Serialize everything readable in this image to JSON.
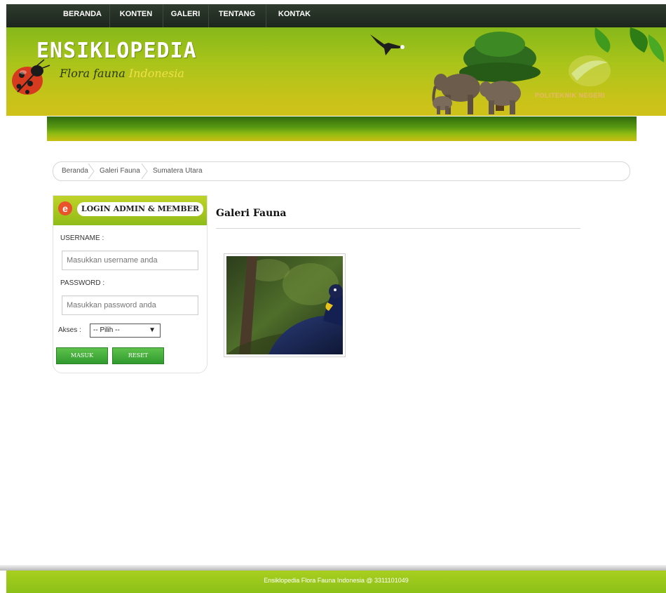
{
  "nav": {
    "items": [
      {
        "label": "BERANDA"
      },
      {
        "label": "KONTEN"
      },
      {
        "label": "GALERI"
      },
      {
        "label": "TENTANG"
      },
      {
        "label": "KONTAK"
      }
    ]
  },
  "header": {
    "title": "ENSIKLOPEDIA",
    "subtitle_main": "Flora fauna",
    "subtitle_accent": "Indonesia",
    "partner": "POLITEKNIK NEGERI"
  },
  "breadcrumb": {
    "items": [
      {
        "label": "Beranda"
      },
      {
        "label": "Galeri Fauna"
      },
      {
        "label": "Sumatera Utara"
      }
    ]
  },
  "login": {
    "badge": "e",
    "title": "LOGIN ADMIN & MEMBER",
    "username_label": "USERNAME :",
    "username_placeholder": "Masukkan username anda",
    "password_label": "PASSWORD :",
    "password_placeholder": "Masukkan password anda",
    "akses_label": "Akses :",
    "akses_selected": "-- Pilih --",
    "submit_label": "MASUK",
    "reset_label": "RESET"
  },
  "content": {
    "title": "Galeri Fauna"
  },
  "footer": {
    "text": "Ensiklopedia Flora Fauna Indonesia @ 3311101049"
  },
  "colors": {
    "nav_bg": "#1d261d",
    "header_green": "#86b81a",
    "header_yellow": "#cfc11a",
    "button_green": "#2f9a2e",
    "footer_green": "#8cc017"
  }
}
